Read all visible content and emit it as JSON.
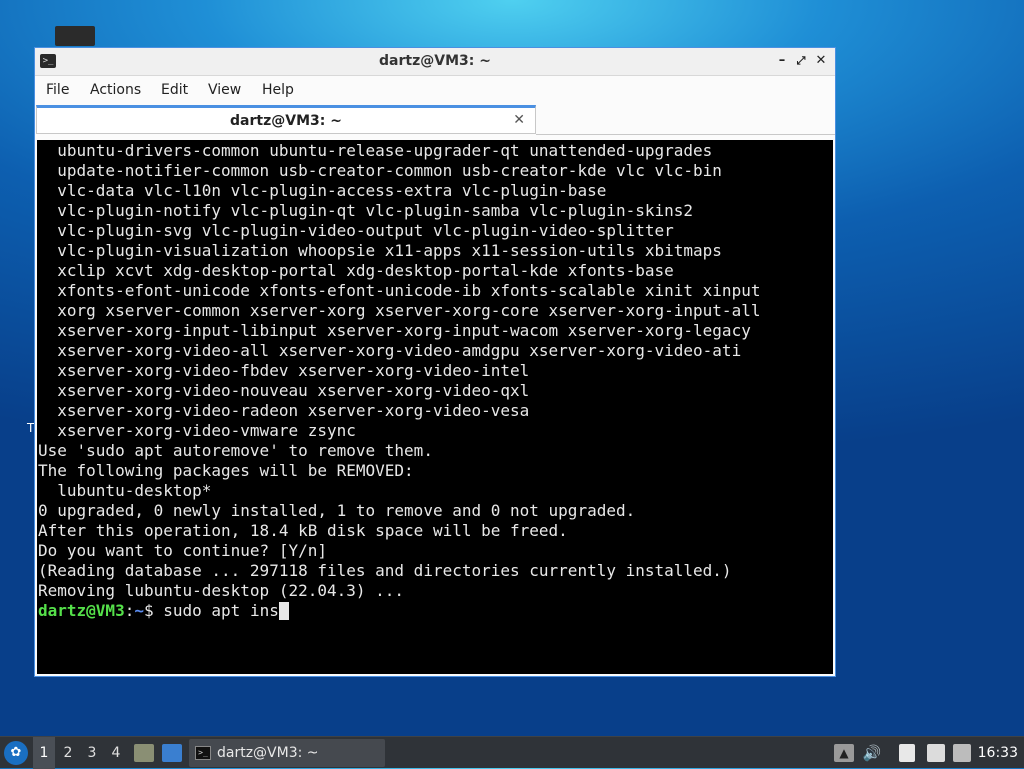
{
  "window": {
    "title": "dartz@VM3: ~",
    "menu": [
      "File",
      "Actions",
      "Edit",
      "View",
      "Help"
    ],
    "tab_label": "dartz@VM3: ~"
  },
  "terminal": {
    "lines": [
      "  ubuntu-drivers-common ubuntu-release-upgrader-qt unattended-upgrades",
      "  update-notifier-common usb-creator-common usb-creator-kde vlc vlc-bin",
      "  vlc-data vlc-l10n vlc-plugin-access-extra vlc-plugin-base",
      "  vlc-plugin-notify vlc-plugin-qt vlc-plugin-samba vlc-plugin-skins2",
      "  vlc-plugin-svg vlc-plugin-video-output vlc-plugin-video-splitter",
      "  vlc-plugin-visualization whoopsie x11-apps x11-session-utils xbitmaps",
      "  xclip xcvt xdg-desktop-portal xdg-desktop-portal-kde xfonts-base",
      "  xfonts-efont-unicode xfonts-efont-unicode-ib xfonts-scalable xinit xinput",
      "  xorg xserver-common xserver-xorg xserver-xorg-core xserver-xorg-input-all",
      "  xserver-xorg-input-libinput xserver-xorg-input-wacom xserver-xorg-legacy",
      "  xserver-xorg-video-all xserver-xorg-video-amdgpu xserver-xorg-video-ati",
      "  xserver-xorg-video-fbdev xserver-xorg-video-intel",
      "  xserver-xorg-video-nouveau xserver-xorg-video-qxl",
      "  xserver-xorg-video-radeon xserver-xorg-video-vesa",
      "  xserver-xorg-video-vmware zsync",
      "Use 'sudo apt autoremove' to remove them.",
      "The following packages will be REMOVED:",
      "  lubuntu-desktop*",
      "0 upgraded, 0 newly installed, 1 to remove and 0 not upgraded.",
      "After this operation, 18.4 kB disk space will be freed.",
      "Do you want to continue? [Y/n]",
      "(Reading database ... 297118 files and directories currently installed.)",
      "Removing lubuntu-desktop (22.04.3) ..."
    ],
    "prompt_user": "dartz@VM3",
    "prompt_sep": ":",
    "prompt_path": "~",
    "prompt_symbol": "$ ",
    "command": "sudo apt ins"
  },
  "desktop": {
    "stray_char": "T"
  },
  "taskbar": {
    "workspaces": [
      "1",
      "2",
      "3",
      "4"
    ],
    "active_workspace": "1",
    "task_label": "dartz@VM3: ~",
    "clock": "16:33",
    "launcher_glyph": "✿",
    "terminal_glyph": ">_"
  }
}
